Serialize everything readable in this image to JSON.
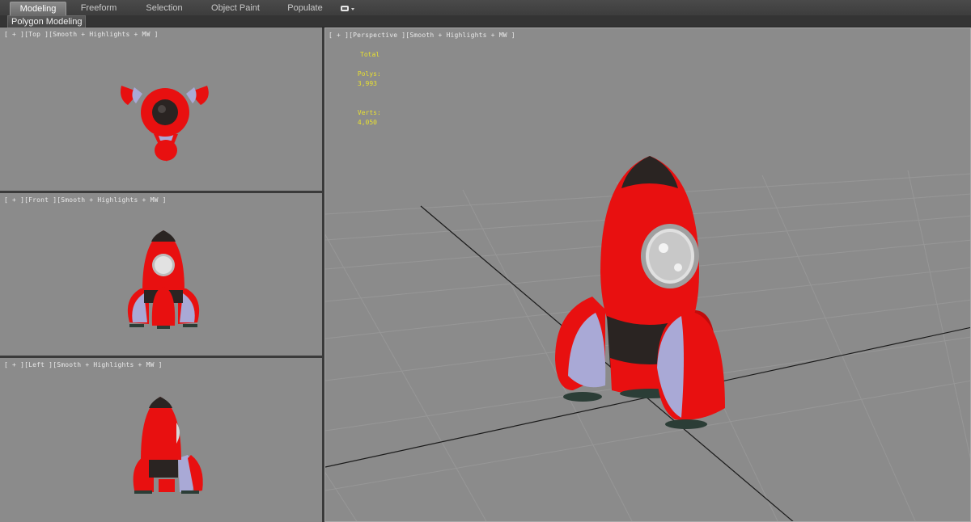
{
  "ribbon": {
    "tabs": [
      {
        "label": "Modeling",
        "active": true
      },
      {
        "label": "Freeform",
        "active": false
      },
      {
        "label": "Selection",
        "active": false
      },
      {
        "label": "Object Paint",
        "active": false
      },
      {
        "label": "Populate",
        "active": false
      }
    ]
  },
  "subbar": {
    "label": "Polygon Modeling"
  },
  "viewports": {
    "top": {
      "label": "[ + ][Top ][Smooth + Highlights + MW ]"
    },
    "front": {
      "label": "[ + ][Front ][Smooth + Highlights + MW ]"
    },
    "left": {
      "label": "[ + ][Left ][Smooth + Highlights + MW ]"
    },
    "perspective": {
      "label": "[ + ][Perspective ][Smooth + Highlights + MW ]",
      "stats": {
        "header": "Total",
        "polys_label": "Polys:",
        "polys_value": "3,993",
        "verts_label": "Verts:",
        "verts_value": "4,050"
      }
    }
  },
  "colors": {
    "viewport_bg": "#8b8b8b",
    "rocket_red": "#e81010",
    "rocket_nose": "#2a2422",
    "fin_metal": "#a9a9d6",
    "stats_text": "#e8e030"
  }
}
